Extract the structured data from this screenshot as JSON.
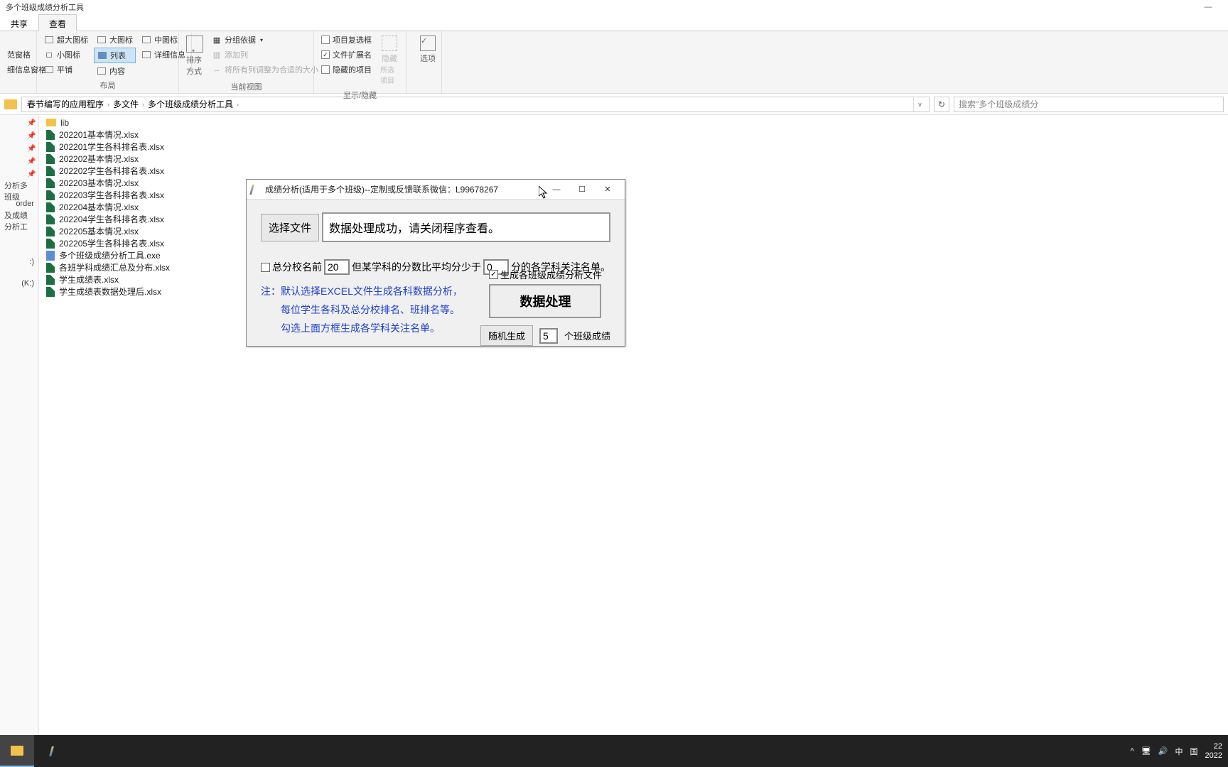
{
  "window_title": "多个班级成绩分析工具",
  "tabs": {
    "share": "共享",
    "view": "查看"
  },
  "ribbon": {
    "pane_group": {
      "item1": "范窗格",
      "item2": "细信息窗格"
    },
    "layout_group": {
      "xl_icon": "超大图标",
      "l_icon": "大图标",
      "m_icon": "中图标",
      "s_icon": "小图标",
      "list": "列表",
      "details": "详细信息",
      "tiles": "平铺",
      "content": "内容",
      "label": "布局"
    },
    "view_group": {
      "sort": "排序方式",
      "group": "分组依据",
      "add_col": "添加列",
      "fit_cols": "将所有列调整为合适的大小",
      "label": "当前视图"
    },
    "show_group": {
      "chk1": "项目复选框",
      "chk2": "文件扩展名",
      "chk3": "隐藏的项目",
      "hide": "隐藏",
      "sel": "所选项目",
      "label": "显示/隐藏"
    },
    "options": "选项"
  },
  "breadcrumb": {
    "seg1": "春节编写的应用程序",
    "seg2": "多文件",
    "seg3": "多个班级成绩分析工具"
  },
  "search_placeholder": "搜索\"多个班级成绩分",
  "nav": {
    "item1": "分析多班级",
    "item2": "order",
    "item3": "及成绩分析工",
    "item4": ":)",
    "item5": "(K:)"
  },
  "files": [
    {
      "name": "lib",
      "type": "folder"
    },
    {
      "name": "202201基本情况.xlsx",
      "type": "xlsx"
    },
    {
      "name": "202201学生各科排名表.xlsx",
      "type": "xlsx"
    },
    {
      "name": "202202基本情况.xlsx",
      "type": "xlsx"
    },
    {
      "name": "202202学生各科排名表.xlsx",
      "type": "xlsx"
    },
    {
      "name": "202203基本情况.xlsx",
      "type": "xlsx"
    },
    {
      "name": "202203学生各科排名表.xlsx",
      "type": "xlsx"
    },
    {
      "name": "202204基本情况.xlsx",
      "type": "xlsx"
    },
    {
      "name": "202204学生各科排名表.xlsx",
      "type": "xlsx"
    },
    {
      "name": "202205基本情况.xlsx",
      "type": "xlsx"
    },
    {
      "name": "202205学生各科排名表.xlsx",
      "type": "xlsx"
    },
    {
      "name": "多个班级成绩分析工具.exe",
      "type": "exe"
    },
    {
      "name": "各班学科成绩汇总及分布.xlsx",
      "type": "xlsx"
    },
    {
      "name": "学生成绩表.xlsx",
      "type": "xlsx"
    },
    {
      "name": "学生成绩表数据处理后.xlsx",
      "type": "xlsx"
    }
  ],
  "dialog": {
    "title": "成绩分析(适用于多个班级)--定制或反馈联系微信：L99678267",
    "select_file": "选择文件",
    "status": "数据处理成功，请关闭程序查看。",
    "chk_rank": "总分校名前",
    "rank_value": "20",
    "mid_text": "但某学科的分数比平均分少于",
    "delta_value": "0",
    "tail_text": "分的各学科关注名单。",
    "gen_chk": "生成各班级成绩分析文件",
    "process_btn": "数据处理",
    "random_btn": "随机生成",
    "random_value": "5",
    "random_tail": "个班级成绩",
    "note1": "注：默认选择EXCEL文件生成各科数据分析，",
    "note2": "每位学生各科及总分校排名、班排名等。",
    "note3": "勾选上面方框生成各学科关注名单。"
  },
  "taskbar": {
    "ime1": "中",
    "ime2": "国",
    "time": "22",
    "date": "2022"
  }
}
